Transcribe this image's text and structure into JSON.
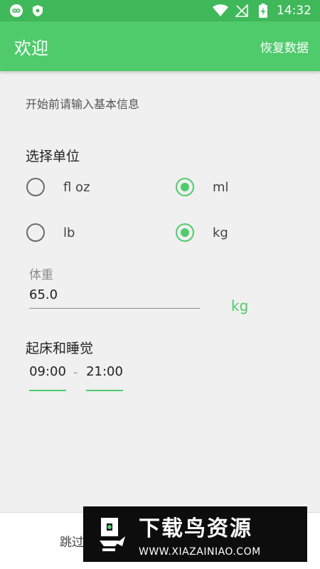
{
  "status_bar": {
    "time": "14:32"
  },
  "app_bar": {
    "title": "欢迎",
    "action": "恢复数据"
  },
  "intro": "开始前请输入基本信息",
  "units": {
    "title": "选择单位",
    "options": [
      {
        "label": "fl oz",
        "checked": false
      },
      {
        "label": "ml",
        "checked": true
      },
      {
        "label": "lb",
        "checked": false
      },
      {
        "label": "kg",
        "checked": true
      }
    ]
  },
  "weight": {
    "label": "体重",
    "value": "65.0",
    "unit": "kg"
  },
  "schedule": {
    "title": "起床和睡觉",
    "wake": "09:00",
    "separator": "-",
    "sleep": "21:00"
  },
  "bottom": {
    "skip": "跳过"
  },
  "watermark": {
    "title": "下载鸟资源",
    "url": "WWW.XIAZAINIAO.COM"
  },
  "colors": {
    "primary": "#4fcb6b",
    "status_bar": "#3fb85a",
    "background": "#f0f0f0"
  }
}
